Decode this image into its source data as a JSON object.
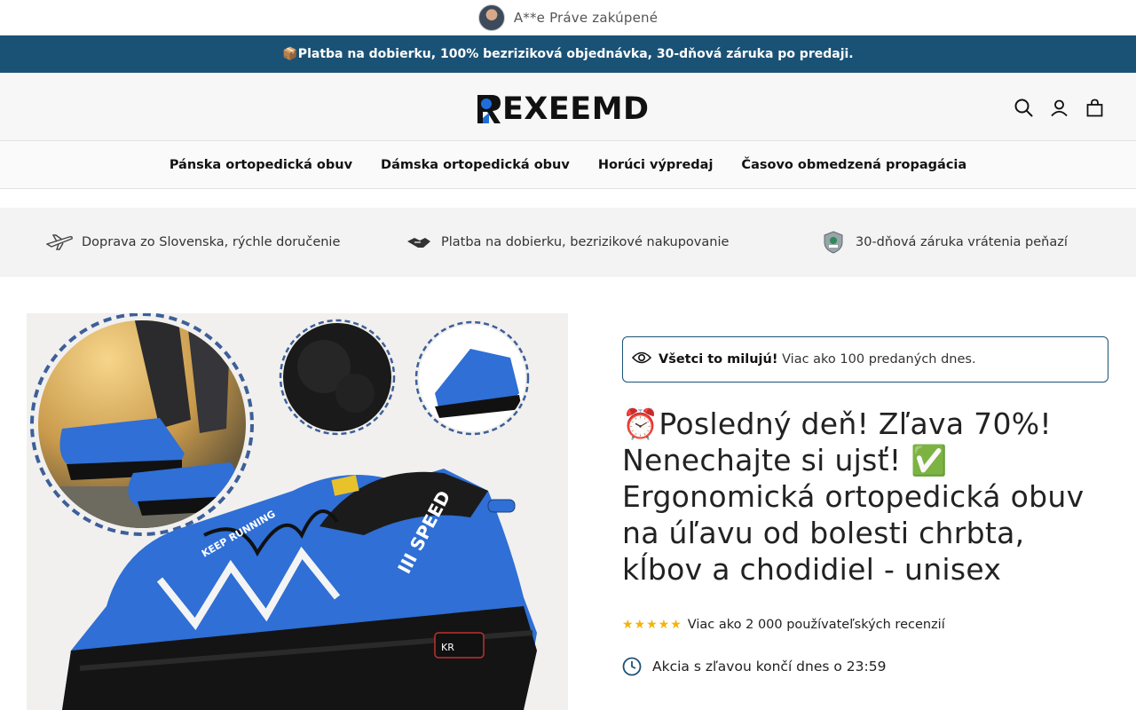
{
  "notification": {
    "text": "A**e Práve zakúpené"
  },
  "announcement": {
    "text": "📦Platba na dobierku, 100% bezriziková objednávka, 30-dňová záruka po predaji."
  },
  "header": {
    "logo_text": "EXEEMD",
    "icons": [
      "search-icon",
      "account-icon",
      "cart-icon"
    ]
  },
  "nav": {
    "items": [
      {
        "label": "Pánska ortopedická obuv"
      },
      {
        "label": "Dámska ortopedická obuv"
      },
      {
        "label": "Horúci výpredaj"
      },
      {
        "label": "Časovo obmedzená propagácia"
      }
    ]
  },
  "features": [
    {
      "icon": "airplane-icon",
      "label": "Doprava zo Slovenska, rýchle doručenie"
    },
    {
      "icon": "handshake-icon",
      "label": "Platba na dobierku, bezrizikové nakupovanie"
    },
    {
      "icon": "shield-icon",
      "label": "30-dňová záruka vrátenia peňazí"
    }
  ],
  "product": {
    "love_strong": "Všetci to milujú!",
    "love_rest": "Viac ako 100 predaných dnes.",
    "title": "⏰Posledný deň! Zľava 70%! Nenechajte si ujsť! ✅ Ergonomická ortopedická obuv na úľavu od bolesti chrbta, kĺbov a chodidiel - unisex",
    "stars": "★★★★★",
    "reviews": "Viac ako 2 000 používateľských recenzií",
    "sale_text": "Akcia s zľavou končí dnes o 23:59",
    "rating": 4.5
  },
  "colors": {
    "announcement_bg": "#1a5276",
    "accent": "#1a5276",
    "star": "#f4b400",
    "shoe_blue": "#2f6fd6"
  }
}
